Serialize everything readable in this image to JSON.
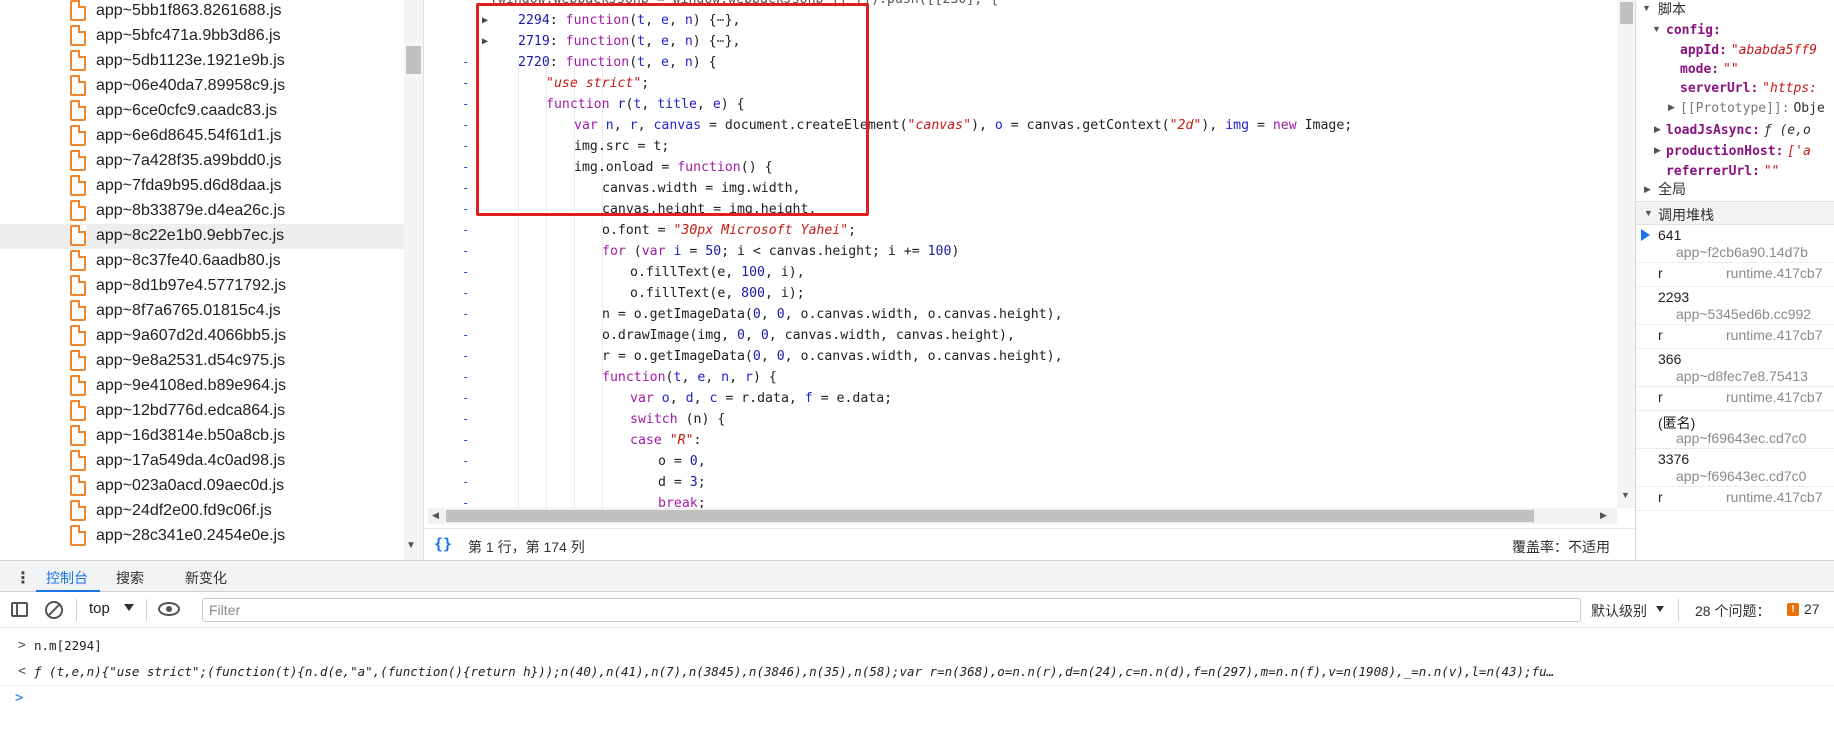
{
  "file_tree": {
    "files": [
      {
        "name": "app~5bb1f863.8261688.js"
      },
      {
        "name": "app~5bfc471a.9bb3d86.js"
      },
      {
        "name": "app~5db1123e.1921e9b.js"
      },
      {
        "name": "app~06e40da7.89958c9.js"
      },
      {
        "name": "app~6ce0cfc9.caadc83.js"
      },
      {
        "name": "app~6e6d8645.54f61d1.js"
      },
      {
        "name": "app~7a428f35.a99bdd0.js"
      },
      {
        "name": "app~7fda9b95.d6d8daa.js"
      },
      {
        "name": "app~8b33879e.d4ea26c.js"
      },
      {
        "name": "app~8c22e1b0.9ebb7ec.js",
        "selected": true
      },
      {
        "name": "app~8c37fe40.6aadb80.js"
      },
      {
        "name": "app~8d1b97e4.5771792.js"
      },
      {
        "name": "app~8f7a6765.01815c4.js"
      },
      {
        "name": "app~9a607d2d.4066bb5.js"
      },
      {
        "name": "app~9e8a2531.d54c975.js"
      },
      {
        "name": "app~9e4108ed.b89e964.js"
      },
      {
        "name": "app~12bd776d.edca864.js"
      },
      {
        "name": "app~16d3814e.b50a8cb.js"
      },
      {
        "name": "app~17a549da.4c0ad98.js"
      },
      {
        "name": "app~023a0acd.09aec0d.js"
      },
      {
        "name": "app~24df2e00.fd9c06f.js"
      },
      {
        "name": "app~28c341e0.2454e0e.js"
      }
    ]
  },
  "editor": {
    "lines": [
      {
        "indent": 0,
        "html": "<span style=\"color:#555\">(window.webpackJsonp = window.webpackJsonp || []).push([[230], {</span>",
        "mark": "-"
      },
      {
        "indent": 1,
        "html": "<span class=\"n\">2294</span>: <span class=\"k\">function</span>(<span class=\"v\">t</span>, <span class=\"v\">e</span>, <span class=\"v\">n</span>) {<span style=\"color:#555\">⋯</span>},",
        "fold": true
      },
      {
        "indent": 1,
        "html": "<span class=\"n\">2719</span>: <span class=\"k\">function</span>(<span class=\"v\">t</span>, <span class=\"v\">e</span>, <span class=\"v\">n</span>) {<span style=\"color:#555\">⋯</span>},",
        "fold": true
      },
      {
        "indent": 1,
        "html": "<span class=\"n\">2720</span>: <span class=\"k\">function</span>(<span class=\"v\">t</span>, <span class=\"v\">e</span>, <span class=\"v\">n</span>) {",
        "mark": "-"
      },
      {
        "indent": 2,
        "html": "<span class=\"s\">\"use strict\"</span>;",
        "mark": "-"
      },
      {
        "indent": 2,
        "html": "<span class=\"k\">function</span> <span class=\"f\">r</span>(<span class=\"v\">t</span>, <span class=\"v\">title</span>, <span class=\"v\">e</span>) {",
        "mark": "-"
      },
      {
        "indent": 3,
        "html": "<span class=\"k\">var</span> <span class=\"v\">n</span>, <span class=\"v\">r</span>, <span class=\"v\">canvas</span> = document.createElement(<span class=\"s\">\"canvas\"</span>), <span class=\"v\">o</span> = canvas.getContext(<span class=\"s\">\"2d\"</span>), <span class=\"v\">img</span> = <span class=\"k\">new</span> Image;",
        "mark": "-"
      },
      {
        "indent": 3,
        "html": "img.src = t;",
        "mark": "-"
      },
      {
        "indent": 3,
        "html": "img.onload = <span class=\"k\">function</span>() {",
        "mark": "-"
      },
      {
        "indent": 4,
        "html": "canvas.width = img.width,",
        "mark": "-"
      },
      {
        "indent": 4,
        "html": "canvas.height = img.height,",
        "mark": "-"
      },
      {
        "indent": 4,
        "html": "o.font = <span class=\"s\">\"30px Microsoft Yahei\"</span>;",
        "mark": "-"
      },
      {
        "indent": 4,
        "html": "<span class=\"k\">for</span> (<span class=\"k\">var</span> <span class=\"v\">i</span> = <span class=\"n\">50</span>; i &lt; canvas.height; i += <span class=\"n\">100</span>)",
        "mark": "-"
      },
      {
        "indent": 5,
        "html": "o.fillText(e, <span class=\"n\">100</span>, i),",
        "mark": "-"
      },
      {
        "indent": 5,
        "html": "o.fillText(e, <span class=\"n\">800</span>, i);",
        "mark": "-"
      },
      {
        "indent": 4,
        "html": "n = o.getImageData(<span class=\"n\">0</span>, <span class=\"n\">0</span>, o.canvas.width, o.canvas.height),",
        "mark": "-"
      },
      {
        "indent": 4,
        "html": "o.drawImage(img, <span class=\"n\">0</span>, <span class=\"n\">0</span>, canvas.width, canvas.height),",
        "mark": "-"
      },
      {
        "indent": 4,
        "html": "r = o.getImageData(<span class=\"n\">0</span>, <span class=\"n\">0</span>, o.canvas.width, o.canvas.height),",
        "mark": "-"
      },
      {
        "indent": 4,
        "html": "<span class=\"k\">function</span>(<span class=\"v\">t</span>, <span class=\"v\">e</span>, <span class=\"v\">n</span>, <span class=\"v\">r</span>) {",
        "mark": "-"
      },
      {
        "indent": 5,
        "html": "<span class=\"k\">var</span> <span class=\"v\">o</span>, <span class=\"v\">d</span>, <span class=\"v\">c</span> = r.data, <span class=\"v\">f</span> = e.data;",
        "mark": "-"
      },
      {
        "indent": 5,
        "html": "<span class=\"k\">switch</span> (n) {",
        "mark": "-"
      },
      {
        "indent": 5,
        "html": "<span class=\"k\">case</span> <span class=\"s\">\"R\"</span>:",
        "mark": "-"
      },
      {
        "indent": 6,
        "html": "o = <span class=\"n\">0</span>,",
        "mark": "-"
      },
      {
        "indent": 6,
        "html": "d = <span class=\"n\">3</span>;",
        "mark": "-"
      },
      {
        "indent": 6,
        "html": "<span class=\"k\">break</span>;",
        "mark": "-"
      }
    ],
    "status_position": "第 1 行，第 174 列",
    "coverage": "覆盖率：不适用"
  },
  "scope_panel": {
    "local_label": "脚本",
    "config_key": "config:",
    "appId_key": "appId:",
    "appId_val": "\"ababda5ff9",
    "mode_key": "mode:",
    "mode_val": "\"\"",
    "serverUrl_key": "serverUrl:",
    "serverUrl_val": "\"https:",
    "prototype_key": "[[Prototype]]:",
    "prototype_val": "Obje",
    "loadJsAsync_key": "loadJsAsync:",
    "loadJsAsync_val": "ƒ (e,o",
    "productionHost_key": "productionHost:",
    "productionHost_val": "['a",
    "referrerUrl_key": "referrerUrl:",
    "referrerUrl_val": "\"\"",
    "global_label": "全局"
  },
  "call_stack": {
    "title": "调用堆栈",
    "frames": [
      {
        "name": "641",
        "loc": "app~f2cb6a90.14d7b",
        "current": true
      },
      {
        "name": "r",
        "loc": "runtime.417cb7",
        "inline": true
      },
      {
        "name": "2293",
        "loc": "app~5345ed6b.cc992"
      },
      {
        "name": "r",
        "loc": "runtime.417cb7",
        "inline": true
      },
      {
        "name": "366",
        "loc": "app~d8fec7e8.75413"
      },
      {
        "name": "r",
        "loc": "runtime.417cb7",
        "inline": true
      },
      {
        "name": "(匿名)",
        "loc": "app~f69643ec.cd7c0"
      },
      {
        "name": "3376",
        "loc": "app~f69643ec.cd7c0"
      },
      {
        "name": "r",
        "loc": "runtime.417cb7",
        "inline": true
      }
    ]
  },
  "drawer": {
    "tabs": [
      "控制台",
      "搜索",
      "新变化"
    ]
  },
  "console_toolbar": {
    "context": "top",
    "filter_placeholder": "Filter",
    "log_level": "默认级别",
    "issues": "28 个问题：",
    "issues_badge": "27"
  },
  "console": {
    "input": "n.m[2294]",
    "result": "ƒ (t,e,n){\"use strict\";(function(t){n.d(e,\"a\",(function(){return h}));n(40),n(41),n(7),n(3845),n(3846),n(35),n(58);var r=n(368),o=n.n(r),d=n(24),c=n.n(d),f=n(297),m=n.n(f),v=n(1908),_=n.n(v),l=n(43);fu…",
    "prompt_in": ">",
    "prompt_out": "<",
    "prompt_active": ">"
  },
  "colors": {
    "accent": "#1a73e8",
    "highlight_box": "#e02020",
    "file_icon": "#f0852f"
  }
}
